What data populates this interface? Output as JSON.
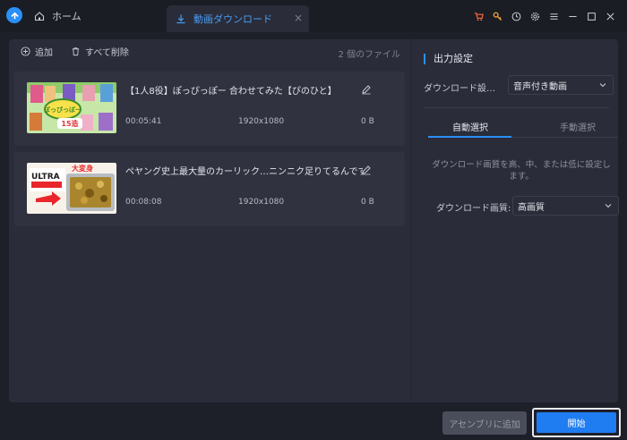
{
  "titlebar": {
    "home_tab_label": "ホーム",
    "download_tab_label": "動画ダウンロード",
    "close_glyph": "×",
    "icons": [
      "cart-icon",
      "key-icon",
      "clock-icon",
      "gear-icon",
      "menu-icon",
      "minimize-icon",
      "maximize-icon",
      "close-icon"
    ]
  },
  "toolbar": {
    "add_label": "追加",
    "delete_all_label": "すべて削除",
    "file_count": "2 個のファイル"
  },
  "videos": [
    {
      "title": "【1人8役】ぽっぴっぽー 合わせてみた【ぴのひと】",
      "duration": "00:05:41",
      "resolution": "1920x1080",
      "size": "0 B",
      "thumb_text": "15造"
    },
    {
      "title": "ペヤング史上最大量のカーリック…ニンニク足りてるんです…",
      "duration": "00:08:08",
      "resolution": "1920x1080",
      "size": "0 B",
      "thumb_text_1": "大変身",
      "thumb_text_2": "ULTRA"
    }
  ],
  "settings": {
    "title": "出力設定",
    "download_label": "ダウンロード設…",
    "download_value": "音声付き動画",
    "tab_auto": "自動選択",
    "tab_manual": "手動選択",
    "description": "ダウンロード画質を高、中、または低に設定します。",
    "quality_label": "ダウンロード画質:",
    "quality_value": "高画質"
  },
  "footer": {
    "append_label": "アセンブリに追加",
    "start_label": "開始"
  },
  "colors": {
    "accent": "#2a8ff7",
    "start_button": "#1f7cf1",
    "panel": "#2a2d39",
    "card": "#30333f"
  }
}
